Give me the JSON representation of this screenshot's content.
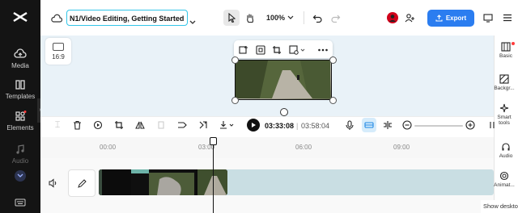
{
  "project": {
    "title": "N1/Video Editing, Getting Started"
  },
  "sidebar": {
    "items": [
      {
        "label": "Media",
        "icon": "cloud-upload-icon"
      },
      {
        "label": "Templates",
        "icon": "templates-icon"
      },
      {
        "label": "Elements",
        "icon": "elements-icon"
      },
      {
        "label": "Audio",
        "icon": "music-note-icon"
      }
    ]
  },
  "topbar": {
    "zoom": "100%",
    "export_label": "Export"
  },
  "canvas": {
    "ratio_label": "16:9"
  },
  "timeline": {
    "current_time": "03:33:08",
    "total_time": "03:58:04",
    "ruler_ticks": [
      "00:00",
      "03:00",
      "06:00",
      "09:00"
    ]
  },
  "right_panel": {
    "items": [
      {
        "label": "Basic",
        "icon": "film-icon"
      },
      {
        "label": "Backgr...",
        "icon": "background-icon"
      },
      {
        "label": "Smart tools",
        "icon": "sparkle-icon"
      },
      {
        "label": "Audio",
        "icon": "audio-icon"
      },
      {
        "label": "Animat...",
        "icon": "animation-icon"
      }
    ]
  },
  "tooltip": {
    "text": "Show deskto"
  },
  "colors": {
    "accent": "#2b7df0",
    "sidebar_bg": "#141414",
    "canvas_bg": "#e9f2f8",
    "title_border": "#33c5e8"
  }
}
